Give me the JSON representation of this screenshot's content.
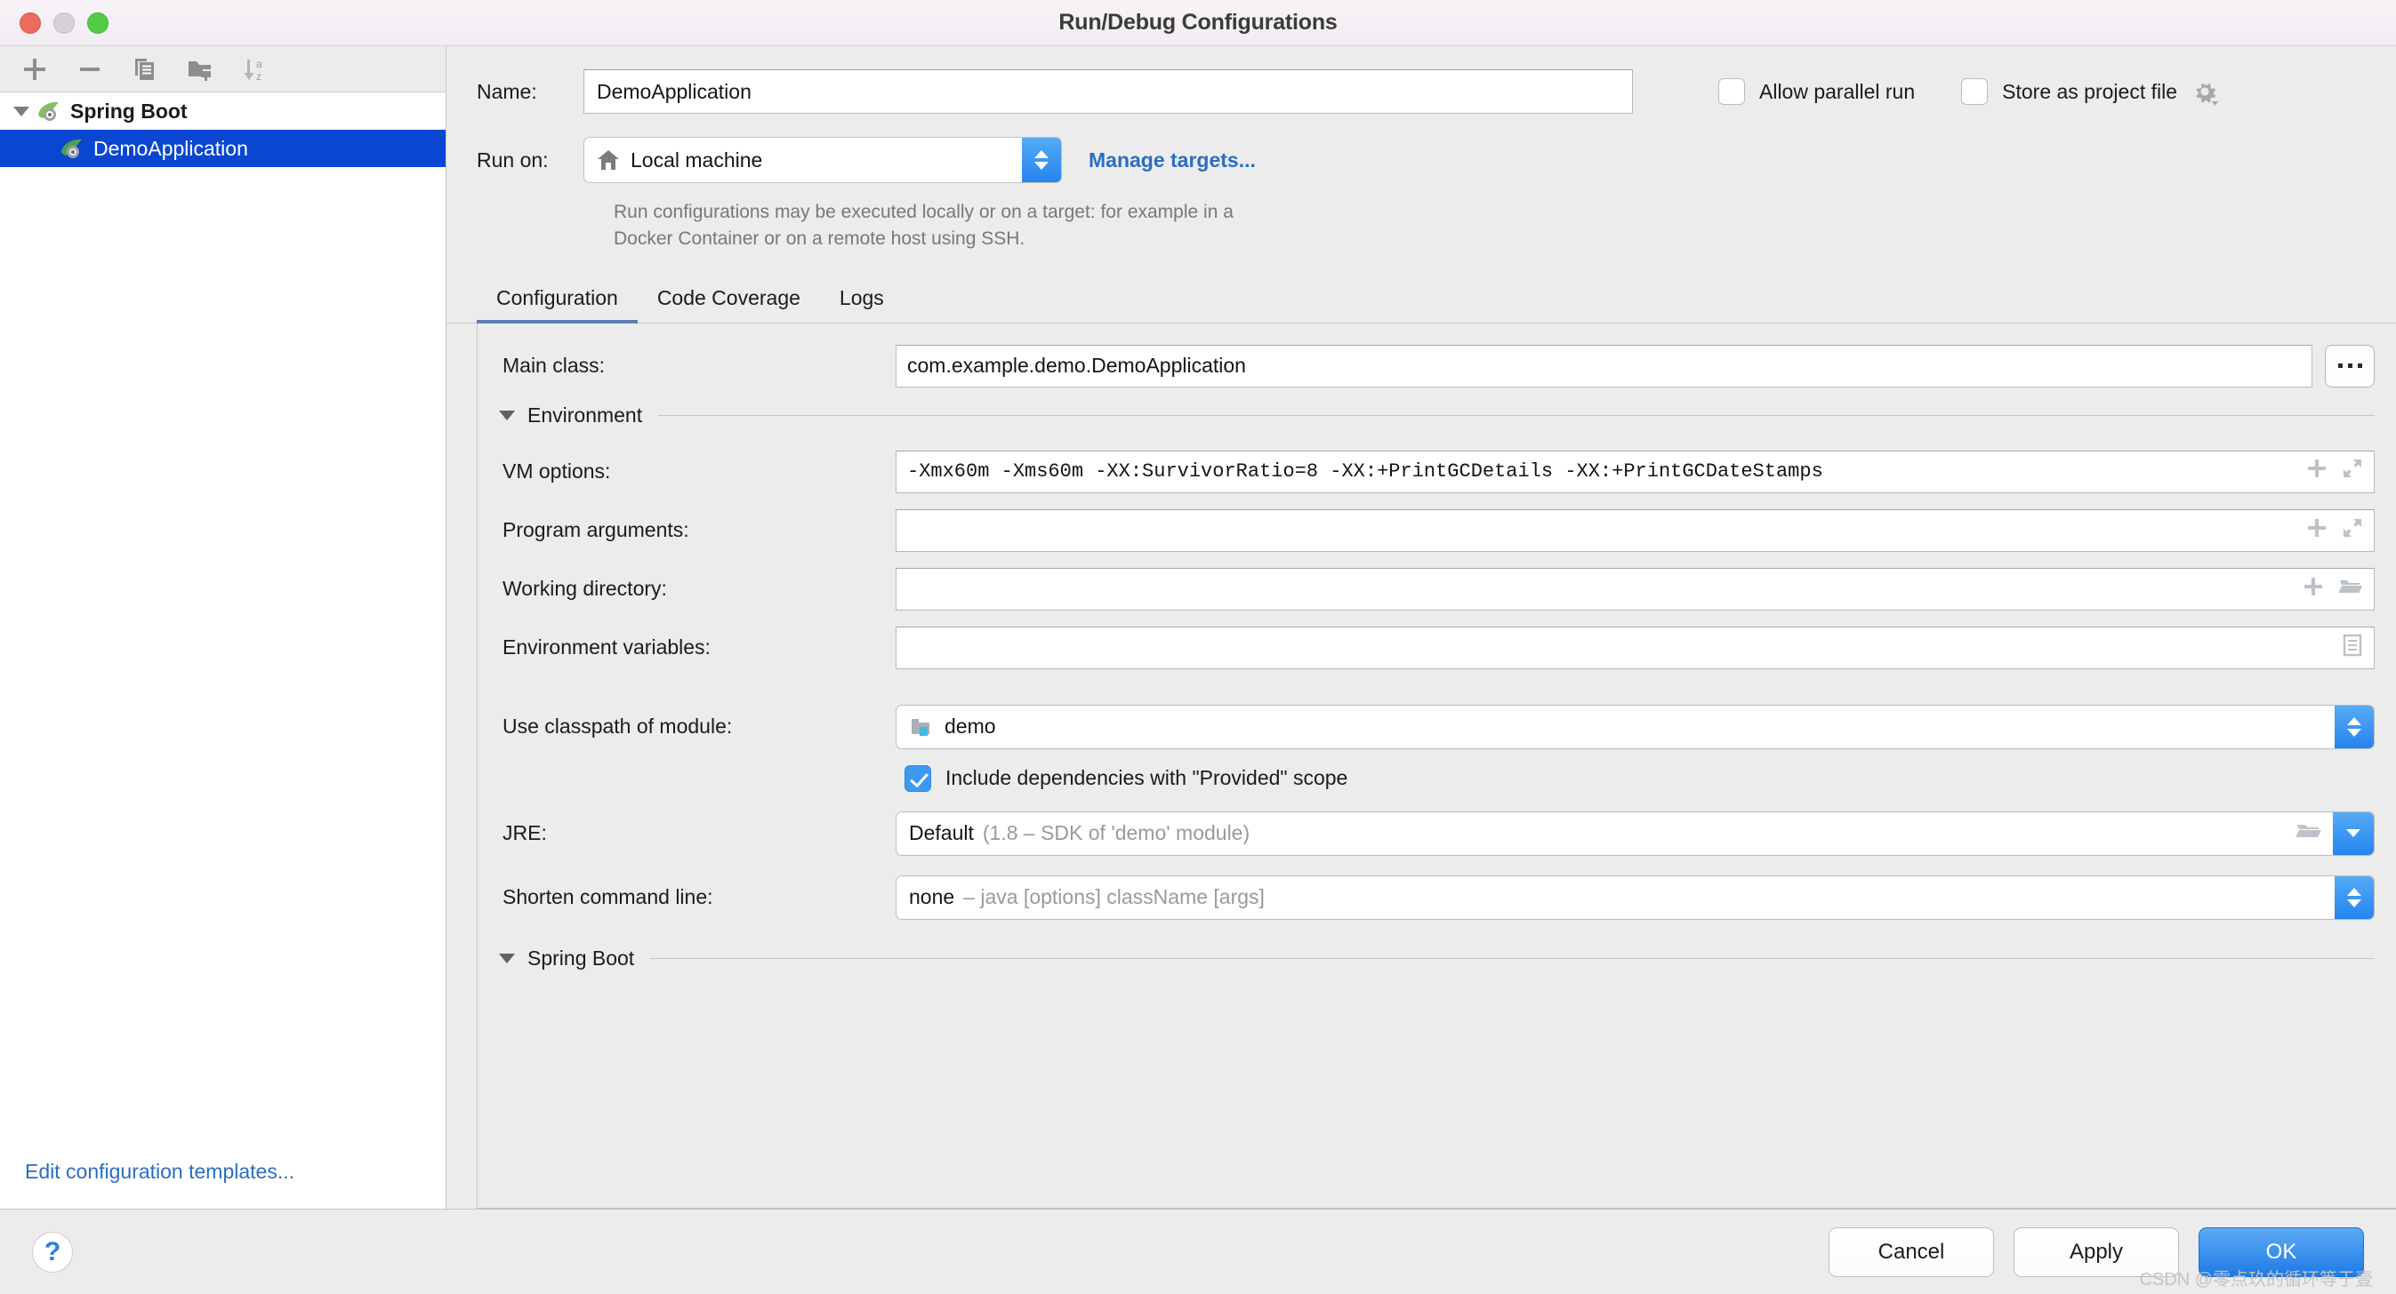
{
  "window": {
    "title": "Run/Debug Configurations",
    "traffic_lights": [
      "close",
      "minimize",
      "maximize"
    ]
  },
  "sidebar": {
    "toolbar": [
      {
        "name": "add-configuration-button",
        "icon": "plus-icon"
      },
      {
        "name": "remove-configuration-button",
        "icon": "minus-icon"
      },
      {
        "name": "copy-configuration-button",
        "icon": "copy-icon"
      },
      {
        "name": "new-folder-button",
        "icon": "folder-add-icon"
      },
      {
        "name": "sort-configurations-button",
        "icon": "sort-az-icon"
      }
    ],
    "tree": [
      {
        "label": "Spring Boot",
        "type": "group",
        "expanded": true,
        "icon": "spring-boot-icon",
        "selected": false
      },
      {
        "label": "DemoApplication",
        "type": "item",
        "icon": "spring-boot-icon",
        "selected": true
      }
    ],
    "edit_templates_link": "Edit configuration templates..."
  },
  "form": {
    "name_label": "Name:",
    "name_value": "DemoApplication",
    "allow_parallel_run": {
      "label": "Allow parallel run",
      "checked": false
    },
    "store_as_project_file": {
      "label": "Store as project file",
      "checked": false,
      "gear_icon": "gear-icon"
    },
    "run_on_label": "Run on:",
    "run_on_value": "Local machine",
    "run_on_icon": "home-icon",
    "manage_targets_link": "Manage targets...",
    "hint": "Run configurations may be executed locally or on a target: for example in a Docker Container or on a remote host using SSH."
  },
  "tabs": [
    {
      "label": "Configuration",
      "active": true
    },
    {
      "label": "Code Coverage",
      "active": false
    },
    {
      "label": "Logs",
      "active": false
    }
  ],
  "configuration": {
    "main_class": {
      "label": "Main class:",
      "value": "com.example.demo.DemoApplication",
      "browse_button": "..."
    },
    "environment_section": {
      "title": "Environment",
      "expanded": true
    },
    "vm_options": {
      "label": "VM options:",
      "value": "-Xmx60m -Xms60m -XX:SurvivorRatio=8 -XX:+PrintGCDetails -XX:+PrintGCDateStamps",
      "icons": [
        "plus-icon",
        "expand-icon"
      ]
    },
    "program_arguments": {
      "label": "Program arguments:",
      "value": "",
      "icons": [
        "plus-icon",
        "expand-icon"
      ]
    },
    "working_directory": {
      "label": "Working directory:",
      "value": "",
      "icons": [
        "plus-icon",
        "folder-icon"
      ]
    },
    "environment_variables": {
      "label": "Environment variables:",
      "value": "",
      "icons": [
        "list-icon"
      ]
    },
    "use_classpath_of_module": {
      "label": "Use classpath of module:",
      "value": "demo",
      "icon": "module-icon"
    },
    "include_provided_scope": {
      "label": "Include dependencies with \"Provided\" scope",
      "checked": true
    },
    "jre": {
      "label": "JRE:",
      "value": "Default",
      "value_hint": "(1.8 – SDK of 'demo' module)",
      "icons": [
        "folder-icon",
        "chevron-down-icon"
      ]
    },
    "shorten_command_line": {
      "label": "Shorten command line:",
      "value": "none",
      "value_hint": "– java [options] className [args]"
    },
    "spring_boot_section": {
      "title": "Spring Boot",
      "expanded": true
    }
  },
  "footer": {
    "help": "?",
    "cancel": "Cancel",
    "apply": "Apply",
    "ok": "OK",
    "watermark": "CSDN @零点玖的循环等于壹"
  },
  "colors": {
    "accent_blue": "#2484ef",
    "selection_blue": "#0a46d2",
    "link_blue": "#2a6ec4",
    "panel_bg": "#ececec",
    "tab_underline": "#5b7fb4"
  }
}
